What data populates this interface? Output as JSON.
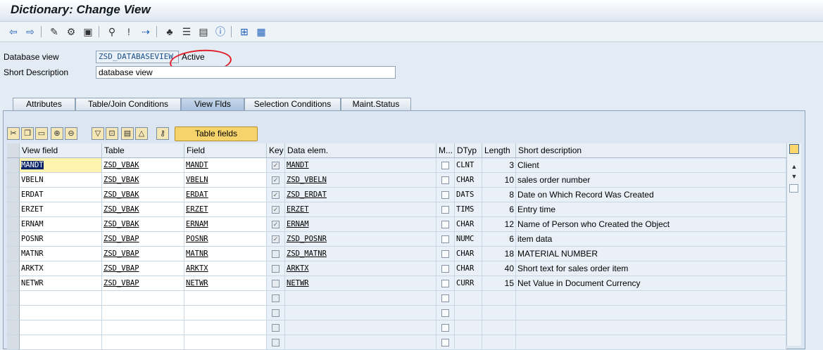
{
  "window": {
    "title": "Dictionary: Change View"
  },
  "toolbar": {
    "icons": [
      "back-arrow-icon",
      "forward-arrow-icon",
      "display-change-icon",
      "other-object-icon",
      "activate-icon",
      "check-icon",
      "where-used-icon",
      "object-list-icon",
      "navigation-icon",
      "hierarchy-icon",
      "info-icon",
      "grid-layout-icon",
      "table-layout-icon"
    ]
  },
  "header": {
    "view_label": "Database view",
    "view_value": "ZSD_DATABASEVIEW",
    "status": "Active",
    "desc_label": "Short Description",
    "desc_value": "database view"
  },
  "tabs": [
    {
      "label": "Attributes"
    },
    {
      "label": "Table/Join Conditions"
    },
    {
      "label": "View Flds"
    },
    {
      "label": "Selection Conditions"
    },
    {
      "label": "Maint.Status"
    }
  ],
  "grid_toolbar": {
    "table_fields_label": "Table fields"
  },
  "columns": {
    "view_field": "View field",
    "table": "Table",
    "field": "Field",
    "key": "Key",
    "data_elem": "Data elem.",
    "m": "M...",
    "dtyp": "DTyp",
    "length": "Length",
    "short_desc": "Short description"
  },
  "rows": [
    {
      "view_field": "MANDT",
      "table": "ZSD_VBAK",
      "field": "MANDT",
      "key": true,
      "data_elem": "MANDT",
      "m": false,
      "dtyp": "CLNT",
      "length": "3",
      "short_desc": "Client"
    },
    {
      "view_field": "VBELN",
      "table": "ZSD_VBAK",
      "field": "VBELN",
      "key": true,
      "data_elem": "ZSD_VBELN",
      "m": false,
      "dtyp": "CHAR",
      "length": "10",
      "short_desc": "sales order number"
    },
    {
      "view_field": "ERDAT",
      "table": "ZSD_VBAK",
      "field": "ERDAT",
      "key": true,
      "data_elem": "ZSD_ERDAT",
      "m": false,
      "dtyp": "DATS",
      "length": "8",
      "short_desc": "Date on Which Record Was Created"
    },
    {
      "view_field": "ERZET",
      "table": "ZSD_VBAK",
      "field": "ERZET",
      "key": true,
      "data_elem": "ERZET",
      "m": false,
      "dtyp": "TIMS",
      "length": "6",
      "short_desc": "Entry time"
    },
    {
      "view_field": "ERNAM",
      "table": "ZSD_VBAK",
      "field": "ERNAM",
      "key": true,
      "data_elem": "ERNAM",
      "m": false,
      "dtyp": "CHAR",
      "length": "12",
      "short_desc": "Name of Person who Created the Object"
    },
    {
      "view_field": "POSNR",
      "table": "ZSD_VBAP",
      "field": "POSNR",
      "key": true,
      "data_elem": "ZSD_POSNR",
      "m": false,
      "dtyp": "NUMC",
      "length": "6",
      "short_desc": "item data"
    },
    {
      "view_field": "MATNR",
      "table": "ZSD_VBAP",
      "field": "MATNR",
      "key": false,
      "data_elem": "ZSD_MATNR",
      "m": false,
      "dtyp": "CHAR",
      "length": "18",
      "short_desc": "MATERIAL NUMBER"
    },
    {
      "view_field": "ARKTX",
      "table": "ZSD_VBAP",
      "field": "ARKTX",
      "key": false,
      "data_elem": "ARKTX",
      "m": false,
      "dtyp": "CHAR",
      "length": "40",
      "short_desc": "Short text for sales order item"
    },
    {
      "view_field": "NETWR",
      "table": "ZSD_VBAP",
      "field": "NETWR",
      "key": false,
      "data_elem": "NETWR",
      "m": false,
      "dtyp": "CURR",
      "length": "15",
      "short_desc": "Net Value in Document Currency"
    }
  ],
  "empty_rows": 4
}
